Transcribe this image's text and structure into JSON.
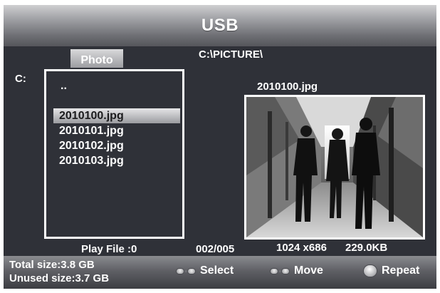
{
  "header": {
    "title": "USB"
  },
  "tabs": {
    "photo_label": "Photo"
  },
  "browser": {
    "current_path": "C:\\PICTURE\\",
    "drive": "C:",
    "parent_item": "..",
    "files": [
      "2010100.jpg",
      "2010101.jpg",
      "2010102.jpg",
      "2010103.jpg"
    ],
    "selected_index": 0
  },
  "preview": {
    "filename": "2010100.jpg",
    "counter": "002/005",
    "dimensions": "1024 x686",
    "file_size": "229.0KB"
  },
  "status": {
    "play_file": "Play File  :0",
    "total_size": "Total size:3.8  GB",
    "unused_size": "Unused size:3.7  GB"
  },
  "hints": {
    "select_label": "Select",
    "move_label": "Move",
    "repeat_label": "Repeat",
    "select_icon": "left-right-buttons-icon",
    "move_icon": "up-down-buttons-icon",
    "repeat_icon": "repeat-button-icon"
  },
  "colors": {
    "background": "#2f3138",
    "highlight": "#d0d0d2",
    "text": "#ffffff"
  }
}
